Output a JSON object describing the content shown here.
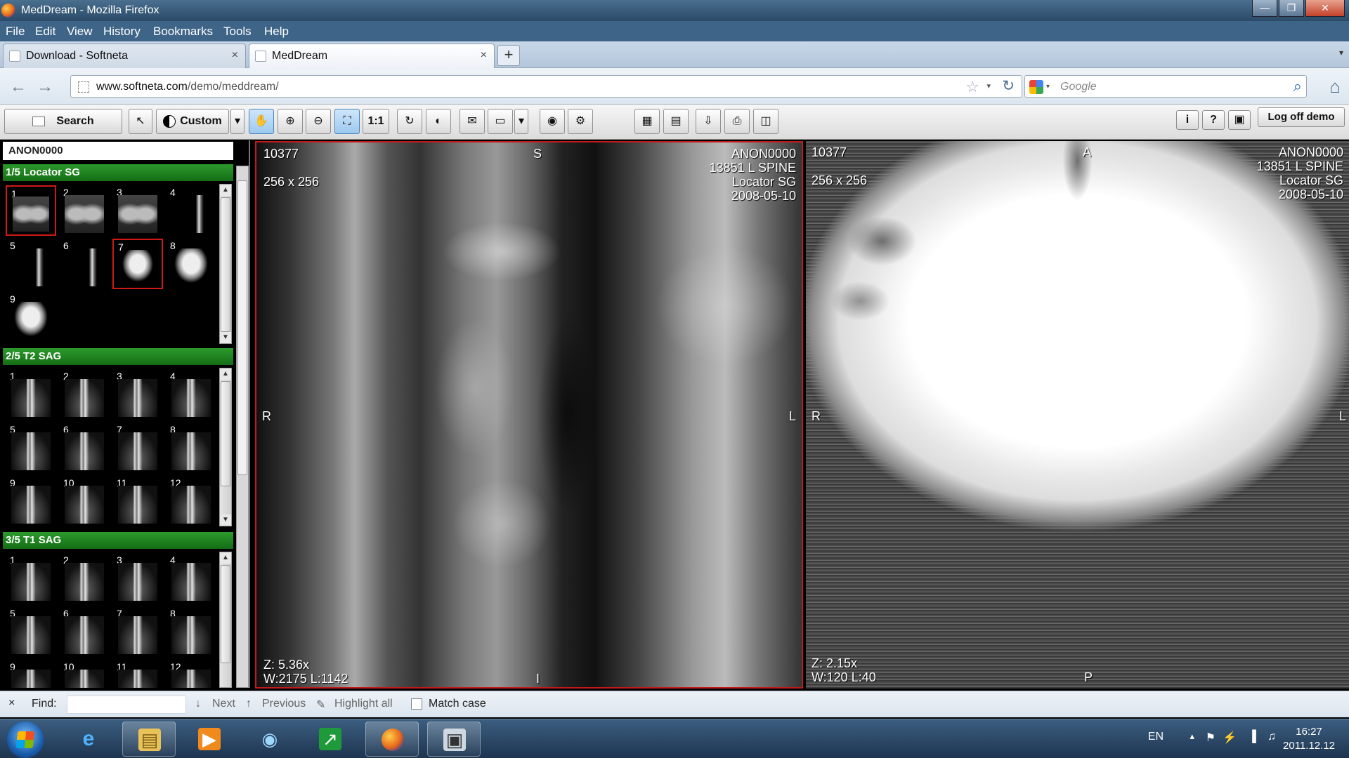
{
  "window": {
    "title": "MedDream - Mozilla Firefox",
    "buttons": {
      "minimize": "—",
      "maximize": "❐",
      "close": "✕"
    }
  },
  "menu": [
    "File",
    "Edit",
    "View",
    "History",
    "Bookmarks",
    "Tools",
    "Help"
  ],
  "tabs": [
    {
      "label": "Download - Softneta",
      "close": "×"
    },
    {
      "label": "MedDream",
      "close": "×"
    }
  ],
  "new_tab": "+",
  "tab_list": "▾",
  "nav": {
    "back": "←",
    "forward": "→",
    "url_host": "www.softneta.com",
    "url_path": "/demo/meddream/",
    "bookmark": "☆",
    "dropdown": "▾",
    "reload": "↻",
    "search_engine_dd": "▾",
    "search_placeholder": "Google",
    "search_icon": "⌕",
    "home": "⌂"
  },
  "toolbar": {
    "search": "Search",
    "pointer": "↖",
    "custom": "Custom",
    "custom_dd": "▾",
    "pan": "✋",
    "zoom_in": "⊕",
    "zoom_out": "⊖",
    "fit": "⛶",
    "one_to_one": "1:1",
    "rotate": "↻",
    "invert": "◐",
    "annotate": "✉",
    "measure": "▭",
    "measure_dd": "▾",
    "probe": "◉",
    "settings": "⚙",
    "grid": "▦",
    "film": "▤",
    "export": "⇩",
    "print": "⎙",
    "compare": "◫",
    "info": "i",
    "help": "?",
    "fullscreen": "▣",
    "logoff": "Log off demo"
  },
  "patient_id": "ANON0000",
  "series": [
    {
      "header": "1/5 Locator SG",
      "thumbs": [
        {
          "n": "1",
          "type": "coronal",
          "selected": true
        },
        {
          "n": "2",
          "type": "coronal",
          "selected": false
        },
        {
          "n": "3",
          "type": "coronal",
          "selected": false
        },
        {
          "n": "4",
          "type": "sliver",
          "selected": false
        },
        {
          "n": "5",
          "type": "sliver",
          "selected": false
        },
        {
          "n": "6",
          "type": "sliver",
          "selected": false
        },
        {
          "n": "7",
          "type": "blob",
          "selected": true
        },
        {
          "n": "8",
          "type": "blob",
          "selected": false
        },
        {
          "n": "9",
          "type": "blob",
          "selected": false
        }
      ]
    },
    {
      "header": "2/5 T2 SAG",
      "thumbs": [
        {
          "n": "1",
          "type": "spine"
        },
        {
          "n": "2",
          "type": "spine"
        },
        {
          "n": "3",
          "type": "spine"
        },
        {
          "n": "4",
          "type": "spine"
        },
        {
          "n": "5",
          "type": "spine"
        },
        {
          "n": "6",
          "type": "spine"
        },
        {
          "n": "7",
          "type": "spine"
        },
        {
          "n": "8",
          "type": "spine"
        },
        {
          "n": "9",
          "type": "spine"
        },
        {
          "n": "10",
          "type": "spine"
        },
        {
          "n": "11",
          "type": "spine"
        },
        {
          "n": "12",
          "type": "spine"
        }
      ]
    },
    {
      "header": "3/5 T1 SAG",
      "thumbs": [
        {
          "n": "1",
          "type": "spine"
        },
        {
          "n": "2",
          "type": "spine"
        },
        {
          "n": "3",
          "type": "spine"
        },
        {
          "n": "4",
          "type": "spine"
        },
        {
          "n": "5",
          "type": "spine"
        },
        {
          "n": "6",
          "type": "spine"
        },
        {
          "n": "7",
          "type": "spine"
        },
        {
          "n": "8",
          "type": "spine"
        },
        {
          "n": "9",
          "type": "spine"
        },
        {
          "n": "10",
          "type": "spine"
        },
        {
          "n": "11",
          "type": "spine"
        },
        {
          "n": "12",
          "type": "spine"
        }
      ]
    }
  ],
  "viewer_left": {
    "image_no": "10377",
    "matrix": "256 x 256",
    "patient": "ANON0000",
    "study": "13851 L SPINE",
    "series": "Locator SG",
    "date": "2008-05-10",
    "orient_top": "S",
    "orient_bottom": "I",
    "orient_left": "R",
    "orient_right": "L",
    "zoom": "Z: 5.36x",
    "window": "W:2175 L:1142"
  },
  "viewer_right": {
    "image_no": "10377",
    "matrix": "256 x 256",
    "patient": "ANON0000",
    "study": "13851 L SPINE",
    "series": "Locator SG",
    "date": "2008-05-10",
    "orient_top": "A",
    "orient_bottom": "P",
    "orient_left": "R",
    "orient_right": "L",
    "zoom": "Z: 2.15x",
    "window": "W:120 L:40"
  },
  "findbar": {
    "close": "×",
    "label": "Find:",
    "next": "Next",
    "previous": "Previous",
    "highlight": "Highlight all",
    "match_case": "Match case",
    "next_arrow": "↓",
    "prev_arrow": "↑",
    "highlight_icon": "✎"
  },
  "taskbar": {
    "lang": "EN",
    "time": "16:27",
    "date": "2011.12.12",
    "tray_up": "▴",
    "flag": "⚑",
    "power": "⚡",
    "network": "▐",
    "volume": "♫",
    "ie": "e",
    "explorer": "▤",
    "media": "▶",
    "wifi": "◉",
    "monitor": "↗",
    "firefox": "●",
    "app": "▣"
  }
}
